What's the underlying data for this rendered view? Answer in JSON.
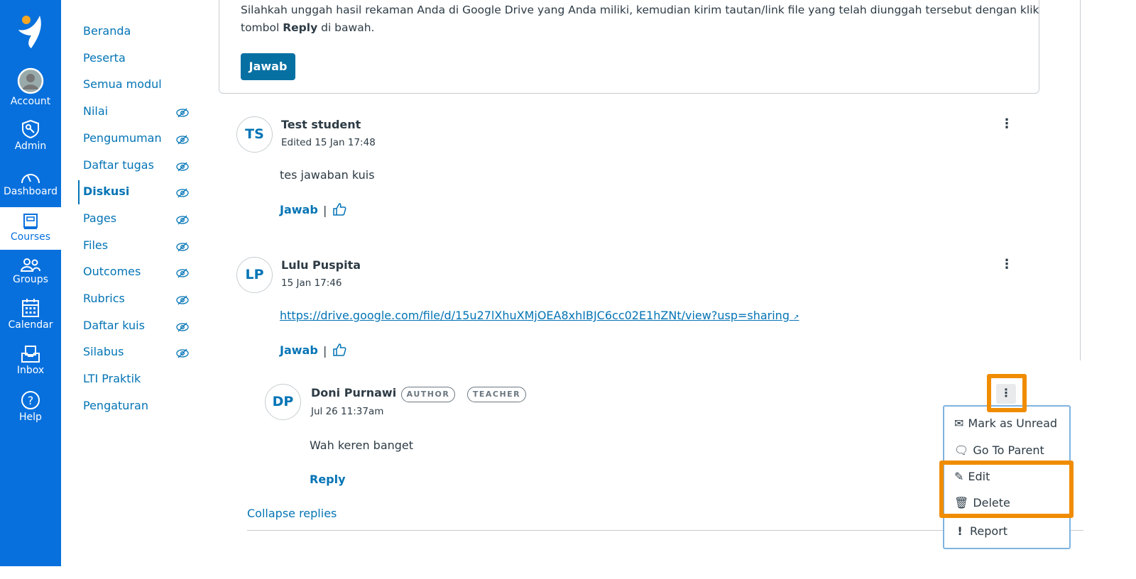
{
  "global_nav": {
    "items": [
      {
        "label": "Account",
        "icon": "avatar-icon"
      },
      {
        "label": "Admin",
        "icon": "shield-key-icon"
      },
      {
        "label": "Dashboard",
        "icon": "speedometer-icon"
      },
      {
        "label": "Courses",
        "icon": "book-icon",
        "active": true
      },
      {
        "label": "Groups",
        "icon": "groups-icon"
      },
      {
        "label": "Calendar",
        "icon": "calendar-icon"
      },
      {
        "label": "Inbox",
        "icon": "inbox-icon"
      },
      {
        "label": "Help",
        "icon": "help-icon"
      }
    ],
    "color": "#0770dd"
  },
  "course_nav": {
    "items": [
      {
        "label": "Beranda",
        "hidden": false
      },
      {
        "label": "Peserta",
        "hidden": false
      },
      {
        "label": "Semua modul",
        "hidden": false
      },
      {
        "label": "Nilai",
        "hidden": true
      },
      {
        "label": "Pengumuman",
        "hidden": true
      },
      {
        "label": "Daftar tugas",
        "hidden": true
      },
      {
        "label": "Diskusi",
        "hidden": true,
        "active": true
      },
      {
        "label": "Pages",
        "hidden": true
      },
      {
        "label": "Files",
        "hidden": true
      },
      {
        "label": "Outcomes",
        "hidden": true
      },
      {
        "label": "Rubrics",
        "hidden": true
      },
      {
        "label": "Daftar kuis",
        "hidden": true
      },
      {
        "label": "Silabus",
        "hidden": true
      },
      {
        "label": "LTI Praktik",
        "hidden": false
      },
      {
        "label": "Pengaturan",
        "hidden": false
      }
    ]
  },
  "topic": {
    "line1": "Silahkah unggah hasil rekaman Anda di Google Drive yang Anda miliki, kemudian kirim tautan/link file yang telah diunggah tersebut dengan klik",
    "line2_pre": "tombol ",
    "line2_bold": "Reply",
    "line2_post": " di bawah.",
    "reply_button": "Jawab"
  },
  "entries": [
    {
      "initials": "TS",
      "name": "Test student",
      "meta": "Edited 15 Jan 17:48",
      "body": "tes jawaban kuis",
      "reply": "Jawab"
    },
    {
      "initials": "LP",
      "name": "Lulu Puspita",
      "meta": "15 Jan 17:46",
      "link": "https://drive.google.com/file/d/15u27lXhuXMjOEA8xhIBJC6cc02E1hZNt/view?usp=sharing",
      "reply": "Jawab"
    }
  ],
  "reply": {
    "initials": "DP",
    "name": "Doni Purnawi",
    "badges": [
      "AUTHOR",
      "TEACHER"
    ],
    "meta": "Jul 26 11:37am",
    "body": "Wah keren banget",
    "reply": "Reply"
  },
  "collapse_replies": "Collapse replies",
  "menu": {
    "items": [
      {
        "label": "Mark as Unread",
        "icon": "mail-unread-icon"
      },
      {
        "label": "Go To Parent",
        "icon": "go-to-parent-icon"
      },
      {
        "label": "Edit",
        "icon": "pencil-icon"
      },
      {
        "label": "Delete",
        "icon": "trash-icon"
      },
      {
        "label": "Report",
        "icon": "exclamation-icon"
      }
    ]
  },
  "highlight_color": "#f08c00"
}
